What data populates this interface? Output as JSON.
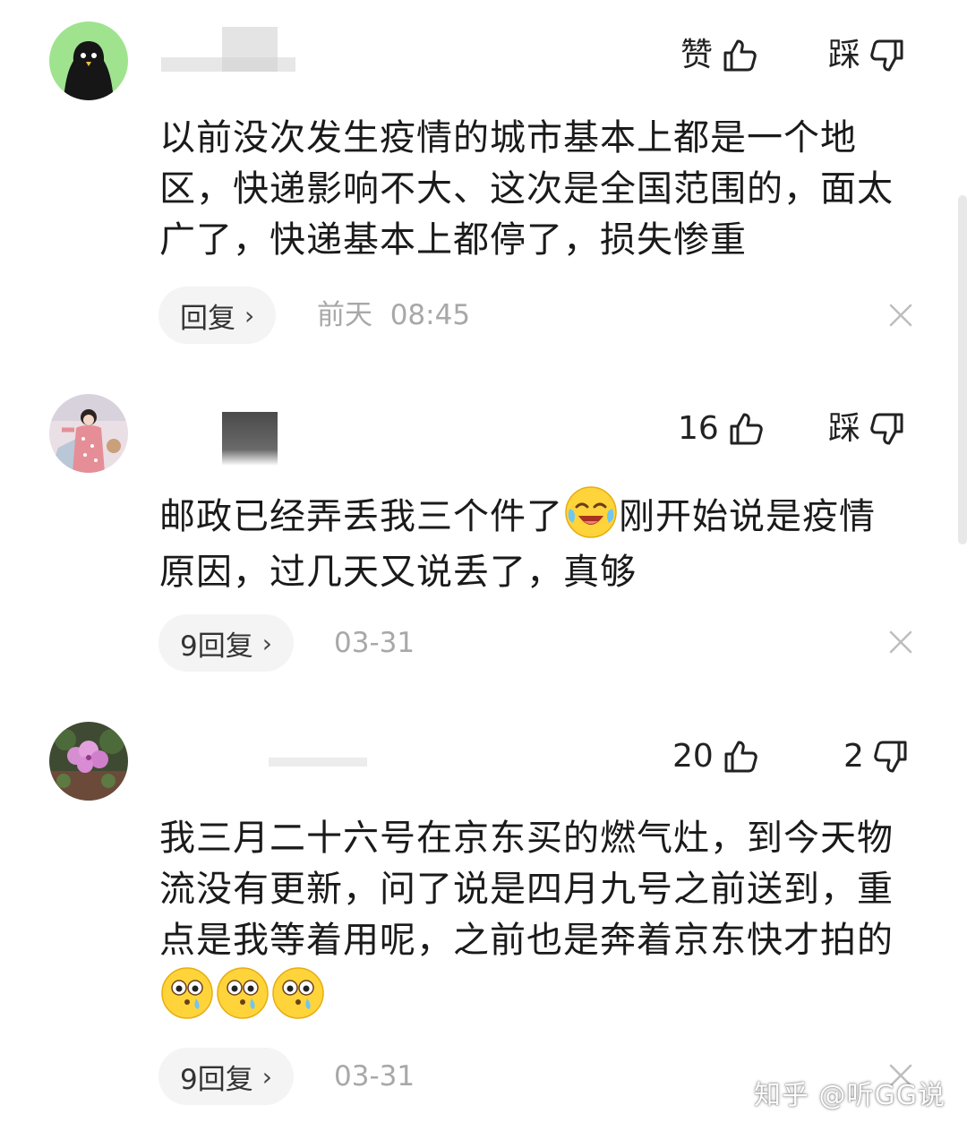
{
  "comments": [
    {
      "like_label": "赞",
      "dislike_label": "踩",
      "text": "以前没次发生疫情的城市基本上都是一个地区，快递影响不大、这次是全国范围的，面太广了，快递基本上都停了，损失惨重",
      "reply_label": "回复",
      "time": "前天  08:45"
    },
    {
      "like_count": "16",
      "dislike_label": "踩",
      "text_before_emoji": "邮政已经弄丢我三个件了",
      "text_after_emoji": "刚开始说是疫情原因，过几天又说丢了，真够",
      "emoji": "crying-laughing-emoji",
      "reply_label": "9回复",
      "time": "03-31"
    },
    {
      "like_count": "20",
      "dislike_count": "2",
      "text": "我三月二十六号在京东买的燃气灶，到今天物流没有更新，问了说是四月九号之前送到，重点是我等着用呢，之前也是奔着京东快才拍的",
      "emoji": "sad-face-emoji",
      "reply_label": "9回复",
      "time": "03-31"
    }
  ],
  "watermark": "知乎 @听GG说",
  "colors": {
    "text": "#1a1a1a",
    "muted": "#a8a8a8",
    "pill": "#f4f4f4",
    "avatar1_bg": "#9fe38f"
  }
}
